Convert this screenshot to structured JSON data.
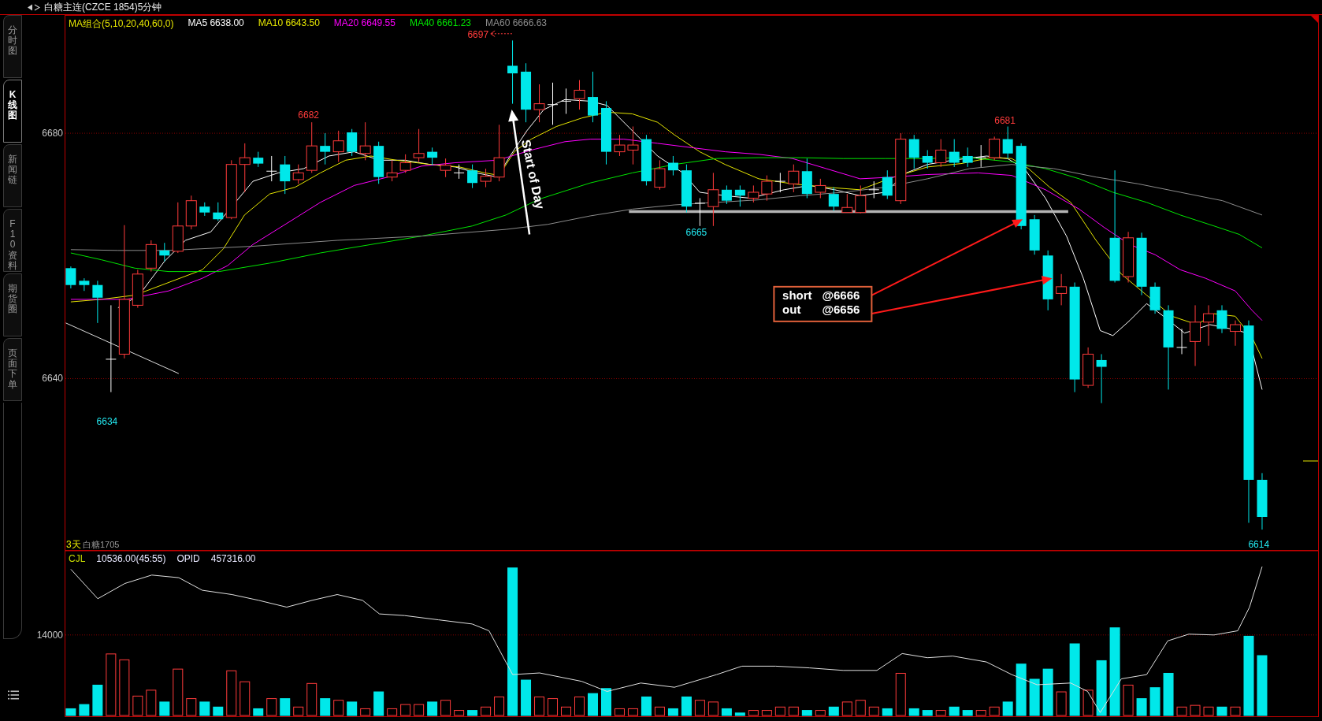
{
  "window": {
    "title": "白糖主连(CZCE 1854)5分钟"
  },
  "sidebar": {
    "tabs": [
      {
        "label": "分时图",
        "selected": false
      },
      {
        "label": "K线图",
        "selected": true
      },
      {
        "label": "新闻链",
        "selected": false
      },
      {
        "label": "F10资料",
        "selected": false
      },
      {
        "label": "期货圈",
        "selected": false
      },
      {
        "label": "页面下单",
        "selected": false
      }
    ]
  },
  "price_panel": {
    "legend": [
      {
        "text": "MA组合(5,10,20,40,60,0)",
        "color": "#e6e600"
      },
      {
        "text": "MA5 6638.00",
        "color": "#ffffff"
      },
      {
        "text": "MA10 6643.50",
        "color": "#e6e600"
      },
      {
        "text": "MA20 6649.55",
        "color": "#ff00ff"
      },
      {
        "text": "MA40 6661.23",
        "color": "#00e600"
      },
      {
        "text": "MA60 6666.63",
        "color": "#8c8c8c"
      }
    ],
    "axis_labels": [
      "6680",
      "6640"
    ],
    "price_marks": [
      {
        "text": "6697",
        "kind": "high"
      },
      {
        "text": "6682",
        "kind": "high"
      },
      {
        "text": "6681",
        "kind": "high"
      },
      {
        "text": "6665",
        "kind": "low"
      },
      {
        "text": "6634",
        "kind": "low"
      },
      {
        "text": "6614",
        "kind": "low"
      }
    ],
    "callout": "Start of Day",
    "annotation": [
      {
        "label": "short",
        "price": "@6666"
      },
      {
        "label": "out",
        "price": "@6656"
      }
    ],
    "contract": {
      "days": "3天",
      "name": "白糖1705"
    }
  },
  "volume_panel": {
    "legend": [
      {
        "text": "CJL",
        "color": "#c8dc00"
      },
      {
        "text": "10536.00(45:55)",
        "color": "#e8e8ff"
      },
      {
        "text": "OPID",
        "color": "#e8e8ff"
      },
      {
        "text": "457316.00",
        "color": "#e8e8ff"
      }
    ],
    "axis_labels": [
      "14000"
    ]
  }
}
